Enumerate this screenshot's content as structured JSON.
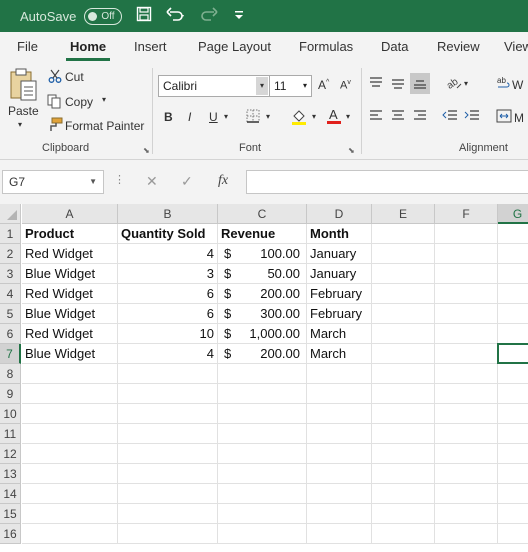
{
  "titlebar": {
    "autosave_label": "AutoSave",
    "toggle_state": "Off",
    "accent": "#217346"
  },
  "menu": {
    "tabs": [
      "File",
      "Home",
      "Insert",
      "Page Layout",
      "Formulas",
      "Data",
      "Review",
      "View"
    ],
    "active": "Home"
  },
  "ribbon": {
    "clipboard": {
      "paste": "Paste",
      "cut": "Cut",
      "copy": "Copy",
      "format_painter": "Format Painter",
      "group_label": "Clipboard"
    },
    "font": {
      "font_name": "Calibri",
      "font_size": "11",
      "bold": "B",
      "italic": "I",
      "underline": "U",
      "group_label": "Font"
    },
    "alignment": {
      "wrap_text": "W",
      "merge": "M",
      "group_label": "Alignment"
    }
  },
  "formula_bar": {
    "name_box": "G7",
    "fx": "fx",
    "value": ""
  },
  "sheet": {
    "columns": [
      "A",
      "B",
      "C",
      "D",
      "E",
      "F",
      "G"
    ],
    "rows": [
      "1",
      "2",
      "3",
      "4",
      "5",
      "6",
      "7",
      "8",
      "9",
      "10",
      "11",
      "12",
      "13",
      "14",
      "15",
      "16"
    ],
    "header": [
      "Product",
      "Quantity Sold",
      "Revenue",
      "Month"
    ],
    "data": [
      {
        "product": "Red Widget",
        "qty": "4",
        "cur": "$",
        "rev": "100.00",
        "month": "January"
      },
      {
        "product": "Blue Widget",
        "qty": "3",
        "cur": "$",
        "rev": "50.00",
        "month": "January"
      },
      {
        "product": "Red Widget",
        "qty": "6",
        "cur": "$",
        "rev": "200.00",
        "month": "February"
      },
      {
        "product": "Blue Widget",
        "qty": "6",
        "cur": "$",
        "rev": "300.00",
        "month": "February"
      },
      {
        "product": "Red Widget",
        "qty": "10",
        "cur": "$",
        "rev": "1,000.00",
        "month": "March"
      },
      {
        "product": "Blue Widget",
        "qty": "4",
        "cur": "$",
        "rev": "200.00",
        "month": "March"
      }
    ],
    "selected_cell": "G7"
  }
}
